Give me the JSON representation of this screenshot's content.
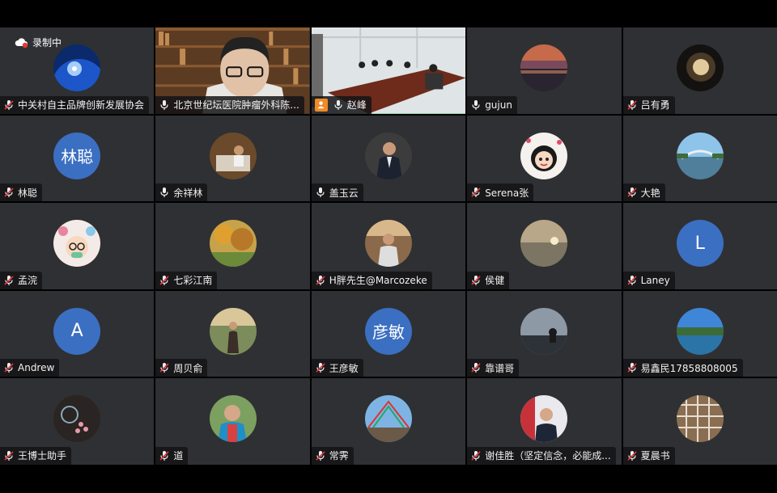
{
  "recording": {
    "label": "录制中"
  },
  "participants": [
    {
      "name": "中关村自主品牌创新发展协会",
      "mic": "muted",
      "kind": "image",
      "art": "earth"
    },
    {
      "name": "北京世纪坛医院肿瘤外科陈...",
      "mic": "on",
      "kind": "video",
      "art": "library"
    },
    {
      "name": "赵峰",
      "mic": "on",
      "kind": "video",
      "art": "meeting",
      "host": true,
      "active": true
    },
    {
      "name": "gujun",
      "mic": "on",
      "kind": "image",
      "art": "sunset"
    },
    {
      "name": "吕有勇",
      "mic": "muted",
      "kind": "image",
      "art": "glow"
    },
    {
      "name": "林聪",
      "mic": "muted",
      "kind": "text",
      "initials": "林聪"
    },
    {
      "name": "余祥林",
      "mic": "on",
      "kind": "image",
      "art": "office"
    },
    {
      "name": "盖玉云",
      "mic": "on",
      "kind": "image",
      "art": "suit"
    },
    {
      "name": "Serena张",
      "mic": "muted",
      "kind": "image",
      "art": "cartoon"
    },
    {
      "name": "大艳",
      "mic": "muted",
      "kind": "image",
      "art": "bridge"
    },
    {
      "name": "孟浣",
      "mic": "muted",
      "kind": "image",
      "art": "balloons"
    },
    {
      "name": "七彩江南",
      "mic": "muted",
      "kind": "image",
      "art": "autumn"
    },
    {
      "name": "H胖先生@Marcozeke",
      "mic": "muted",
      "kind": "image",
      "art": "man-room"
    },
    {
      "name": "侯健",
      "mic": "muted",
      "kind": "image",
      "art": "sea"
    },
    {
      "name": "Laney",
      "mic": "muted",
      "kind": "text",
      "initials": "L"
    },
    {
      "name": "Andrew",
      "mic": "muted",
      "kind": "text",
      "initials": "A"
    },
    {
      "name": "周贝俞",
      "mic": "muted",
      "kind": "image",
      "art": "girl"
    },
    {
      "name": "王彦敏",
      "mic": "muted",
      "kind": "text",
      "initials": "彦敏"
    },
    {
      "name": "靠谱哥",
      "mic": "muted",
      "kind": "image",
      "art": "sky"
    },
    {
      "name": "易鑫民17858808005",
      "mic": "muted",
      "kind": "image",
      "art": "lake"
    },
    {
      "name": "王博士助手",
      "mic": "muted",
      "kind": "image",
      "art": "flower"
    },
    {
      "name": "道",
      "mic": "muted",
      "kind": "image",
      "art": "elder"
    },
    {
      "name": "常霁",
      "mic": "muted",
      "kind": "image",
      "art": "flags"
    },
    {
      "name": "谢佳胜（坚定信念，必能成...",
      "mic": "muted",
      "kind": "image",
      "art": "host-man"
    },
    {
      "name": "夏晨书",
      "mic": "muted",
      "kind": "image",
      "art": "grid"
    }
  ],
  "colors": {
    "tile_bg": "#2f3033",
    "active_border": "#22c05a",
    "avatar_blue": "#3b6fc2",
    "muted_red": "#e0393e",
    "host_orange": "#f08a24"
  }
}
